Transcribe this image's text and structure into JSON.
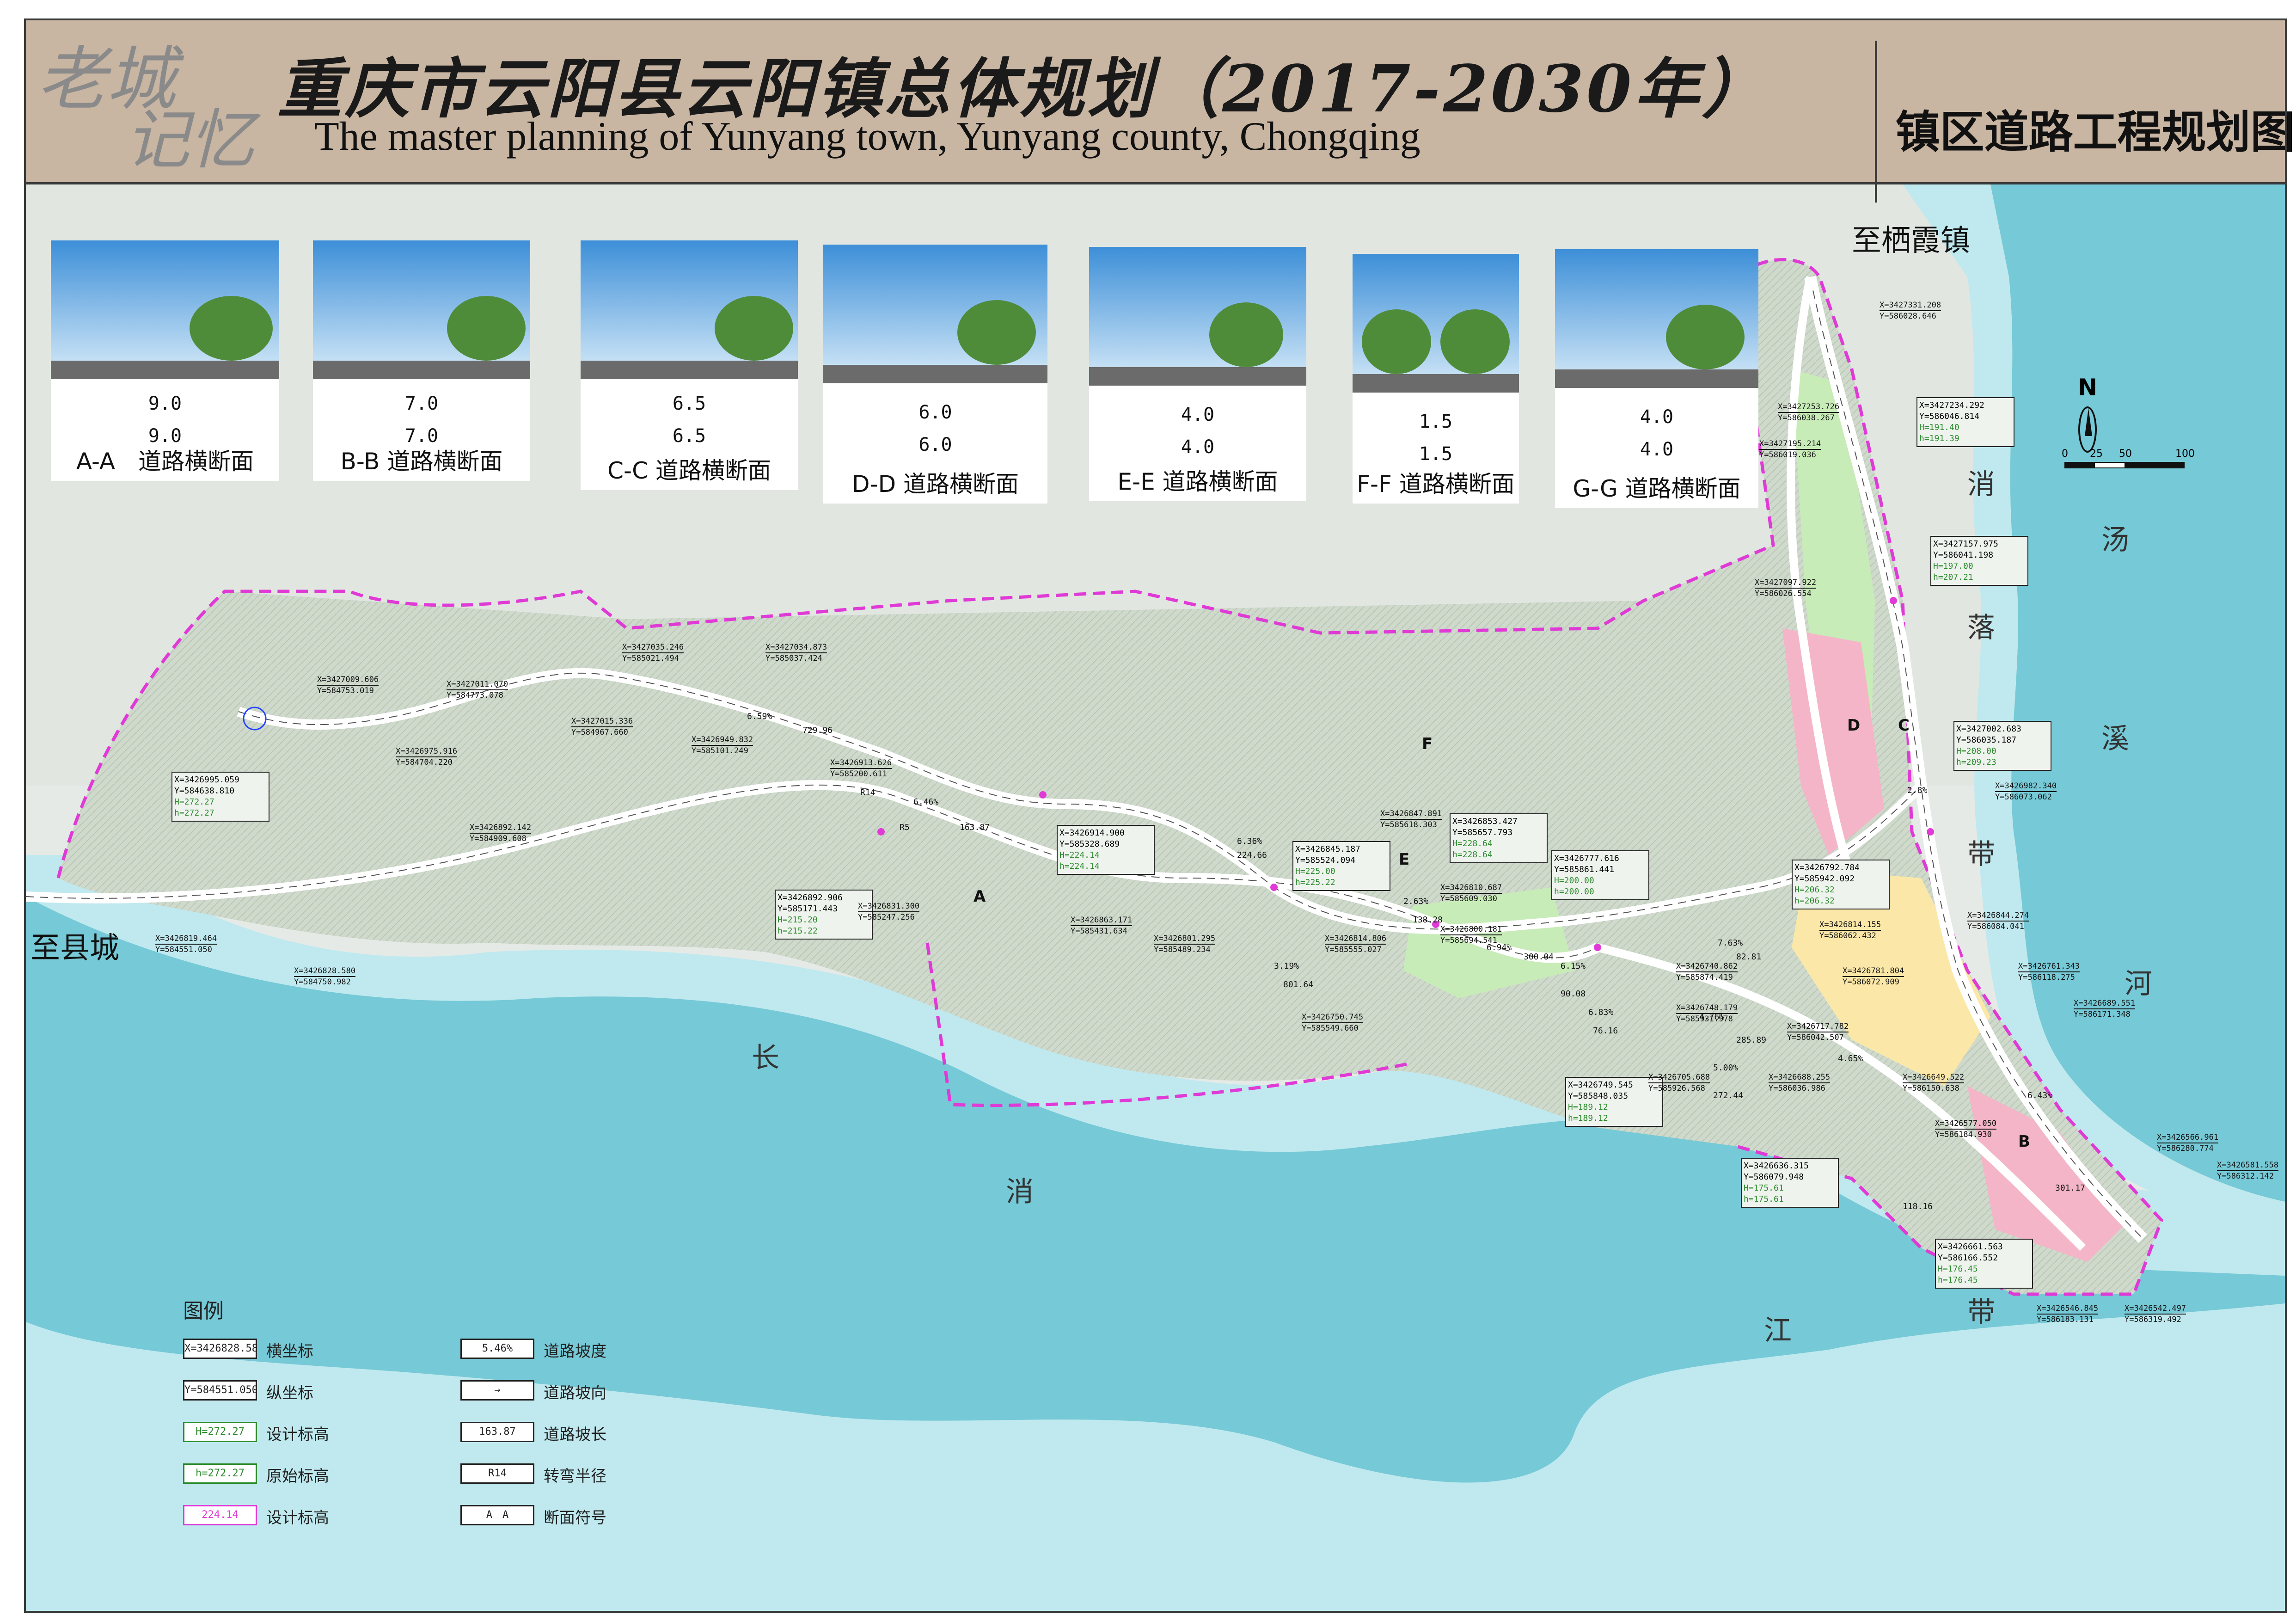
{
  "header": {
    "logo_line1": "老城",
    "logo_line2": "记忆",
    "title_cn": "重庆市云阳县云阳镇总体规划（2017-2030年）",
    "title_en": "The master planning of  Yunyang town, Yunyang county, Chongqing",
    "sheet_name": "镇区道路工程规划图"
  },
  "cross_sections": [
    {
      "label": "A-A　道路横断面",
      "dim_top": "9.0",
      "dim_bottom": "9.0"
    },
    {
      "label": "B-B 道路横断面",
      "dim_top": "7.0",
      "dim_bottom": "7.0"
    },
    {
      "label": "C-C 道路横断面",
      "dim_top": "6.5",
      "dim_bottom": "6.5"
    },
    {
      "label": "D-D 道路横断面",
      "dim_top": "6.0",
      "dim_bottom": "6.0"
    },
    {
      "label": "E-E 道路横断面",
      "dim_top": "4.0",
      "dim_bottom": "4.0"
    },
    {
      "label": "F-F 道路横断面",
      "dim_top": "1.5",
      "dim_bottom": "1.5"
    },
    {
      "label": "G-G 道路横断面",
      "dim_top": "4.0",
      "dim_bottom": "4.0"
    }
  ],
  "places": {
    "to_town": "至栖霞镇",
    "to_county": "至县城",
    "north_label": "N",
    "scale_ticks": [
      "0",
      "25",
      "50",
      "100"
    ]
  },
  "water": {
    "chars_right_east": [
      "汤",
      "溪",
      "河"
    ],
    "chars_right_west": [
      "消",
      "落",
      "带"
    ],
    "chars_bottom": [
      "长",
      "消",
      "江",
      "带"
    ]
  },
  "legend": {
    "title": "图例",
    "items": [
      {
        "sample": "X=3426828.580",
        "text": "横坐标"
      },
      {
        "sample": "Y=584551.050",
        "text": "纵坐标"
      },
      {
        "sample": "H=272.27",
        "text": "设计标高"
      },
      {
        "sample": "h=272.27",
        "text": "原始标高"
      },
      {
        "sample": "224.14",
        "text": "设计标高"
      },
      {
        "sample": "5.46%",
        "text": "道路坡度"
      },
      {
        "sample": "→",
        "text": "道路坡向"
      },
      {
        "sample": "163.87",
        "text": "道路坡长"
      },
      {
        "sample": "R14",
        "text": "转弯半径"
      },
      {
        "sample": "A　A",
        "text": "断面符号"
      }
    ]
  },
  "coordinate_boxes": [
    {
      "x": "X=3426995.059",
      "y": "Y=584638.810",
      "H": "H=272.27",
      "h": "h=272.27"
    },
    {
      "x": "X=3426892.906",
      "y": "Y=585171.443",
      "H": "H=215.20",
      "h": "h=215.22"
    },
    {
      "x": "X=3426914.900",
      "y": "Y=585328.689",
      "H": "H=224.14",
      "h": "h=224.14"
    },
    {
      "x": "X=3426845.187",
      "y": "Y=585524.094",
      "H": "H=225.00",
      "h": "h=225.22"
    },
    {
      "x": "X=3426853.427",
      "y": "Y=585657.793",
      "H": "H=228.64",
      "h": "h=228.64"
    },
    {
      "x": "X=3426777.616",
      "y": "Y=585861.441",
      "H": "H=200.00",
      "h": "h=200.00"
    },
    {
      "x": "X=3426792.784",
      "y": "Y=585942.092",
      "H": "H=206.32",
      "h": "h=206.32"
    },
    {
      "x": "X=3427234.292",
      "y": "Y=586046.814",
      "H": "H=191.40",
      "h": "h=191.39"
    },
    {
      "x": "X=3427157.975",
      "y": "Y=586041.198",
      "H": "H=197.00",
      "h": "h=207.21"
    },
    {
      "x": "X=3427002.683",
      "y": "Y=586035.187",
      "H": "H=208.00",
      "h": "h=209.23"
    },
    {
      "x": "X=3426749.545",
      "y": "Y=585848.035",
      "H": "H=189.12",
      "h": "h=189.12"
    },
    {
      "x": "X=3426636.315",
      "y": "Y=586079.948",
      "H": "H=175.61",
      "h": "h=175.61"
    },
    {
      "x": "X=3426661.563",
      "y": "Y=586166.552",
      "H": "H=176.45",
      "h": "h=176.45"
    }
  ],
  "point_labels": [
    {
      "x": "X=3427009.606",
      "y": "Y=584753.019"
    },
    {
      "x": "X=3427011.070",
      "y": "Y=584773.078"
    },
    {
      "x": "X=3427035.246",
      "y": "Y=585021.494"
    },
    {
      "x": "X=3427034.873",
      "y": "Y=585037.424"
    },
    {
      "x": "X=3427015.336",
      "y": "Y=584967.660"
    },
    {
      "x": "X=3426975.916",
      "y": "Y=584704.220"
    },
    {
      "x": "X=3426949.832",
      "y": "Y=585101.249"
    },
    {
      "x": "X=3426913.626",
      "y": "Y=585200.611"
    },
    {
      "x": "X=3426892.142",
      "y": "Y=584909.608"
    },
    {
      "x": "X=3426819.464",
      "y": "Y=584551.050"
    },
    {
      "x": "X=3426828.580",
      "y": "Y=584750.982"
    },
    {
      "x": "X=3426831.300",
      "y": "Y=585247.256"
    },
    {
      "x": "X=3426863.171",
      "y": "Y=585431.634"
    },
    {
      "x": "X=3426801.295",
      "y": "Y=585489.234"
    },
    {
      "x": "X=3426814.806",
      "y": "Y=585555.027"
    },
    {
      "x": "X=3426750.745",
      "y": "Y=585549.660"
    },
    {
      "x": "X=3426847.891",
      "y": "Y=585618.303"
    },
    {
      "x": "X=3426810.687",
      "y": "Y=585609.030"
    },
    {
      "x": "X=3426800.181",
      "y": "Y=585694.541"
    },
    {
      "x": "X=3426814.155",
      "y": "Y=586062.432"
    },
    {
      "x": "X=3426740.862",
      "y": "Y=585874.419"
    },
    {
      "x": "X=3426748.179",
      "y": "Y=585931.978"
    },
    {
      "x": "X=3426717.782",
      "y": "Y=586042.507"
    },
    {
      "x": "X=3426705.688",
      "y": "Y=585926.568"
    },
    {
      "x": "X=3426688.255",
      "y": "Y=586036.986"
    },
    {
      "x": "X=3426781.804",
      "y": "Y=586072.909"
    },
    {
      "x": "X=3427331.208",
      "y": "Y=586028.646"
    },
    {
      "x": "X=3427253.726",
      "y": "Y=586038.267"
    },
    {
      "x": "X=3427195.214",
      "y": "Y=586019.036"
    },
    {
      "x": "X=3427097.922",
      "y": "Y=586026.554"
    },
    {
      "x": "X=3426982.340",
      "y": "Y=586073.062"
    },
    {
      "x": "X=3426844.274",
      "y": "Y=586084.041"
    },
    {
      "x": "X=3426761.343",
      "y": "Y=586118.275"
    },
    {
      "x": "X=3426689.551",
      "y": "Y=586171.348"
    },
    {
      "x": "X=3426649.522",
      "y": "Y=586150.638"
    },
    {
      "x": "X=3426577.050",
      "y": "Y=586184.930"
    },
    {
      "x": "X=3426566.961",
      "y": "Y=586280.774"
    },
    {
      "x": "X=3426581.558",
      "y": "Y=586312.142"
    },
    {
      "x": "X=3426546.845",
      "y": "Y=586183.131"
    },
    {
      "x": "X=3426542.497",
      "y": "Y=586319.492"
    }
  ],
  "road_notes": {
    "grades": [
      "6.59%",
      "6.46%",
      "6.36%",
      "3.19%",
      "2.63%",
      "6.94%",
      "6.15%",
      "7.63%",
      "6.83%",
      "4.76%",
      "5.00%",
      "4.65%",
      "2.8%",
      "6.43%"
    ],
    "lengths": [
      "729.96",
      "163.87",
      "224.66",
      "801.64",
      "138.28",
      "300.04",
      "90.08",
      "82.81",
      "76.16",
      "285.89",
      "272.44",
      "118.16",
      "301.17"
    ],
    "radius": [
      "R5",
      "R14"
    ],
    "section_marks": [
      "A",
      "B",
      "C",
      "D",
      "E",
      "F"
    ]
  },
  "colors": {
    "water_deep": "#76c9d6",
    "water_light": "#bfe9ef",
    "land": "#c9d7c4",
    "boundary": "#e03ad6",
    "road": "#ffffff",
    "title_band": "#c8b5a2",
    "commercial": "#f4b5c8",
    "residential": "#fbe8a8",
    "green": "#c8ecb8"
  }
}
